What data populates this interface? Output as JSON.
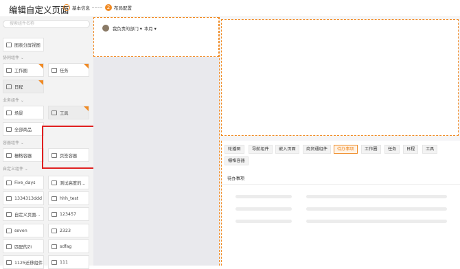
{
  "header": {
    "title": "编辑自定义页面",
    "steps": [
      {
        "num": "✓",
        "label": "基本信息"
      },
      {
        "num": "2",
        "label": "布局配置"
      }
    ]
  },
  "sidebar": {
    "search_placeholder": "搜索组件名称",
    "top_item": "图表分屏视图",
    "groups": {
      "collab": "协同组件",
      "business": "业务组件",
      "container": "容器组件",
      "custom": "自定义组件"
    },
    "collab_items": [
      "工作圈",
      "任务",
      "日程"
    ],
    "business_items": [
      "场景",
      "工具",
      "全部商品"
    ],
    "container_items": [
      "栅格容器",
      "页签容器"
    ],
    "custom_items": [
      "Five_days",
      "测试高度的...",
      "1334313ddd",
      "hhh_test",
      "自定义页面...",
      "123457",
      "seven",
      "2323",
      "匹配的ZI",
      "sdfag",
      "1125迁移组件",
      "111"
    ]
  },
  "canvas": {
    "dept_filter": "我负责的部门",
    "time_filter": "本月"
  },
  "right": {
    "tabs": [
      "轮播图",
      "导航组件",
      "嵌入页面",
      "商贸通组件",
      "待办事项",
      "工作圈",
      "任务",
      "日程",
      "工具",
      "栅格容器"
    ],
    "active_tab": "待办事项",
    "section_title": "待办事项"
  },
  "colors": {
    "accent": "#f08a24",
    "highlight": "#e02020"
  }
}
